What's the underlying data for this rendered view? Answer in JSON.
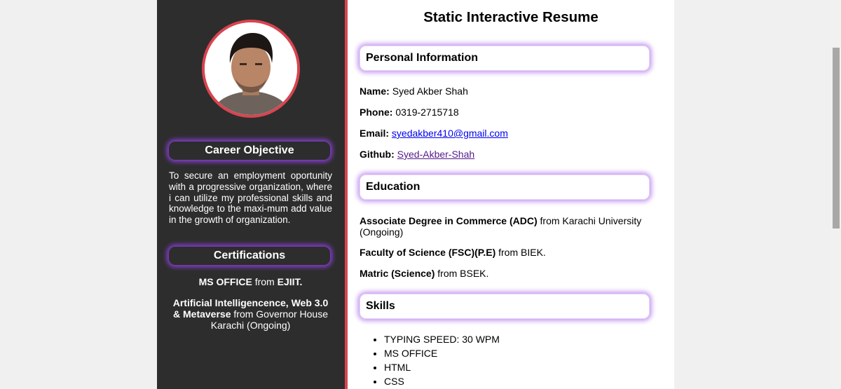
{
  "page_title": "Static Interactive Resume",
  "sidebar": {
    "photo_icon": "profile-photo",
    "career_objective": {
      "heading": "Career Objective",
      "text": "To secure an employment oportunity with a progressive organization, where i can utilize my professional skills and knowledge to the maxi-mum add value in the growth of organization."
    },
    "certifications": {
      "heading": "Certifications",
      "items": [
        {
          "name": "MS OFFICE",
          "from": " from ",
          "org": "EJIIT."
        },
        {
          "name": "Artificial Intelligencence, Web 3.0 & Metaverse",
          "from": " from ",
          "org": "Governor House Karachi (Ongoing)"
        }
      ]
    }
  },
  "personal": {
    "heading": "Personal Information",
    "name_label": "Name:",
    "name": "Syed Akber Shah",
    "phone_label": "Phone:",
    "phone": "0319-2715718",
    "email_label": "Email:",
    "email": "syedakber410@gmail.com",
    "github_label": "Github:",
    "github": "Syed-Akber-Shah"
  },
  "education": {
    "heading": "Education",
    "items": [
      {
        "degree": "Associate Degree in Commerce (ADC)",
        "from": " from Karachi University (Ongoing)"
      },
      {
        "degree": "Faculty of Science (FSC)(P.E)",
        "from": " from BIEK."
      },
      {
        "degree": "Matric (Science)",
        "from": " from BSEK."
      }
    ]
  },
  "skills": {
    "heading": "Skills",
    "items": [
      "TYPING SPEED: 30 WPM",
      "MS OFFICE",
      "HTML",
      "CSS"
    ]
  },
  "colors": {
    "sidebar_bg": "#2d2d2d",
    "accent_red": "#d9444f",
    "glow_purple": "#8a3fd6",
    "heading_glow": "#c79cf2",
    "link_blue": "#0000ee",
    "link_visited": "#551a8b"
  }
}
